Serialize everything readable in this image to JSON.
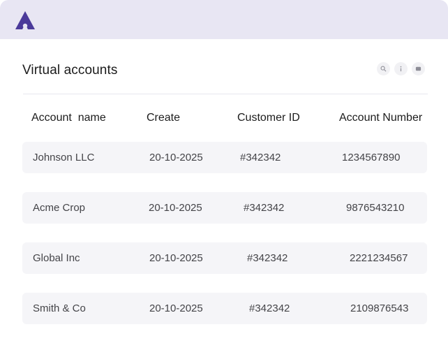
{
  "app": {
    "logo_icon": "brand-triangle-logo-icon",
    "brand_color": "#4b3a9a"
  },
  "header": {
    "title": "Virtual accounts",
    "tools": [
      "search-icon",
      "info-icon",
      "more-icon"
    ]
  },
  "table": {
    "columns": [
      "Account  name",
      "Create",
      "Customer ID",
      "Account Number"
    ],
    "rows": [
      {
        "name": "Johnson LLC",
        "created": "20-10-2025",
        "customer_id": "#342342",
        "account_number": "1234567890"
      },
      {
        "name": "Acme Crop",
        "created": "20-10-2025",
        "customer_id": "#342342",
        "account_number": "9876543210"
      },
      {
        "name": "Global Inc",
        "created": "20-10-2025",
        "customer_id": "#342342",
        "account_number": "2221234567"
      },
      {
        "name": "Smith & Co",
        "created": "20-10-2025",
        "customer_id": "#342342",
        "account_number": "2109876543"
      }
    ]
  }
}
